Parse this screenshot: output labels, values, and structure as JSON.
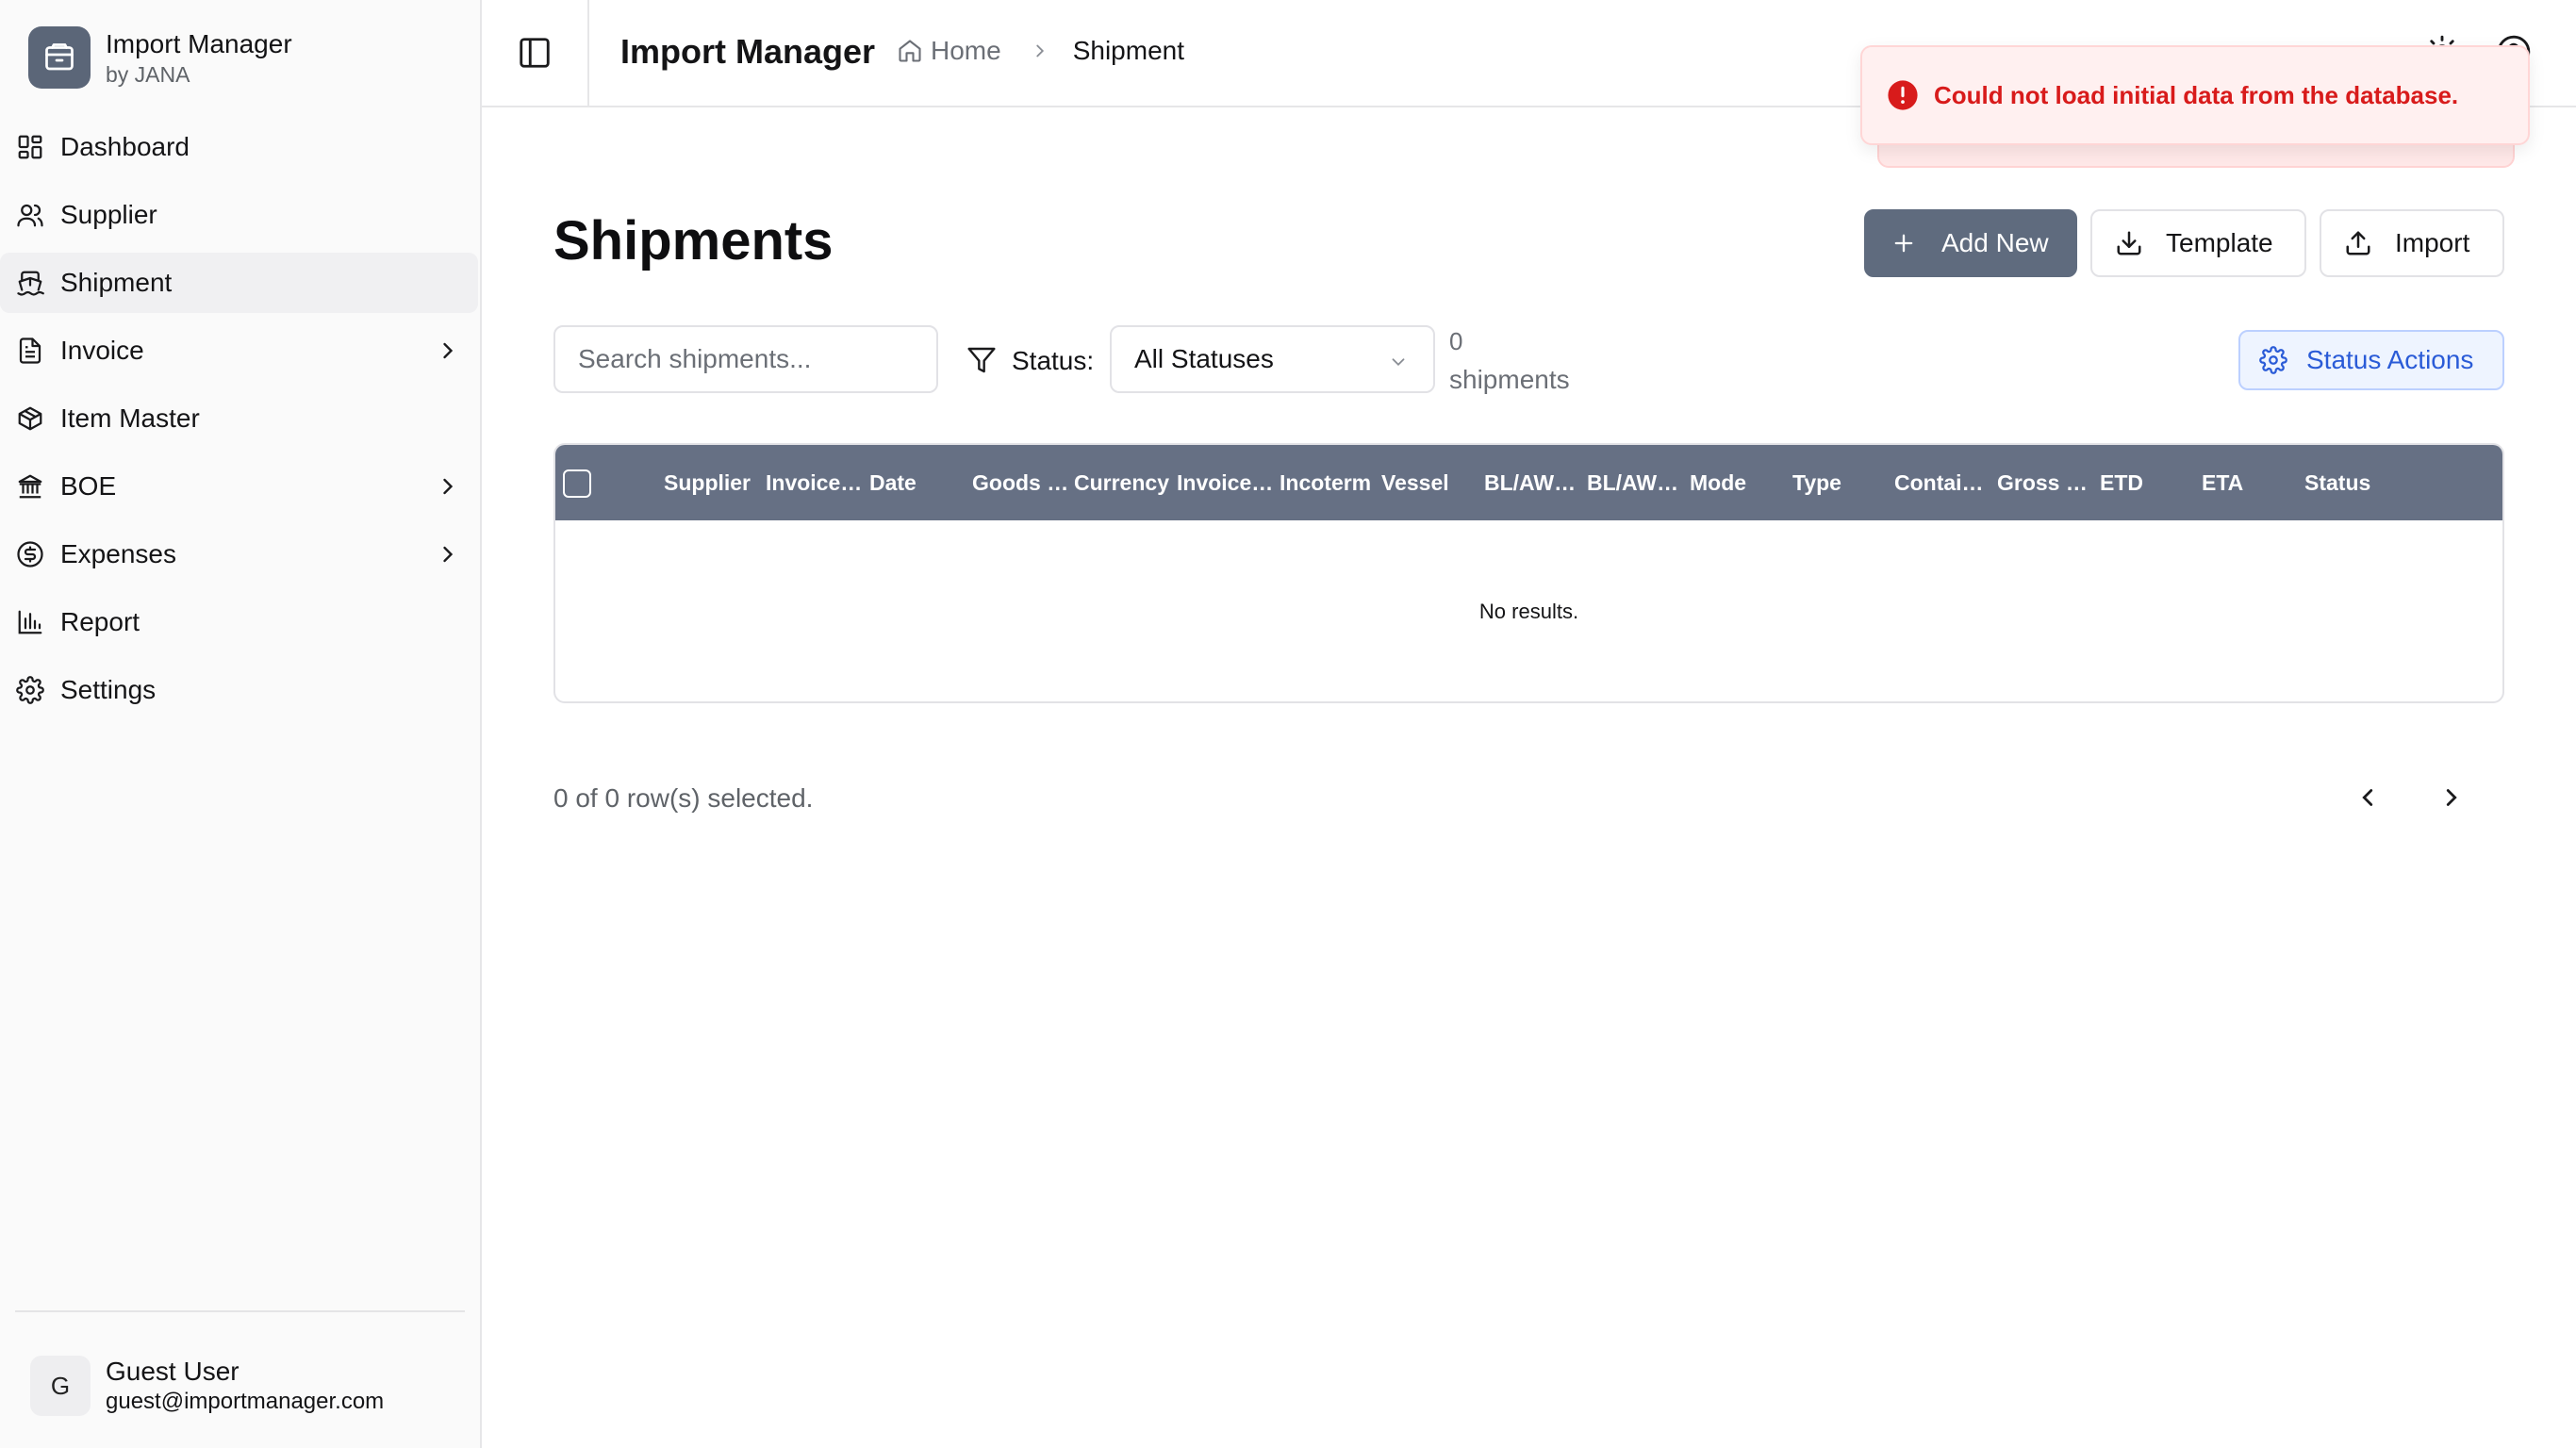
{
  "brand": {
    "title": "Import Manager",
    "subtitle": "by JANA"
  },
  "sidebar": {
    "items": [
      {
        "label": "Dashboard"
      },
      {
        "label": "Supplier"
      },
      {
        "label": "Shipment"
      },
      {
        "label": "Invoice"
      },
      {
        "label": "Item Master"
      },
      {
        "label": "BOE"
      },
      {
        "label": "Expenses"
      },
      {
        "label": "Report"
      },
      {
        "label": "Settings"
      }
    ],
    "active_item": "Shipment"
  },
  "user": {
    "initial": "G",
    "name": "Guest User",
    "email": "guest@importmanager.com"
  },
  "header": {
    "title": "Import Manager",
    "breadcrumb": {
      "home": "Home",
      "current": "Shipment"
    }
  },
  "page": {
    "title": "Shipments",
    "buttons": {
      "add_new": "Add New",
      "template": "Template",
      "import": "Import"
    },
    "search": {
      "placeholder": "Search shipments...",
      "value": ""
    },
    "filter": {
      "label": "Status:",
      "selected": "All Statuses"
    },
    "count": {
      "value": "0",
      "label": "shipments"
    },
    "status_actions": "Status Actions"
  },
  "table": {
    "columns": [
      "Supplier",
      "Invoice…",
      "Date",
      "Goods …",
      "Currency",
      "Invoice…",
      "Incoterm",
      "Vessel",
      "BL/AW…",
      "BL/AW…",
      "Mode",
      "Type",
      "Contai…",
      "Gross …",
      "ETD",
      "ETA",
      "Status"
    ],
    "rows": [],
    "empty_message": "No results."
  },
  "footer": {
    "selection": "0 of 0 row(s) selected."
  },
  "toast": {
    "message": "Could not load initial data from the database.",
    "type": "error"
  },
  "colors": {
    "primary": "#5f6b7e",
    "table_header": "#667084",
    "error": "#d81b1b",
    "toast_bg": "#fff0f0",
    "accent_blue": "#2a5bd7"
  }
}
